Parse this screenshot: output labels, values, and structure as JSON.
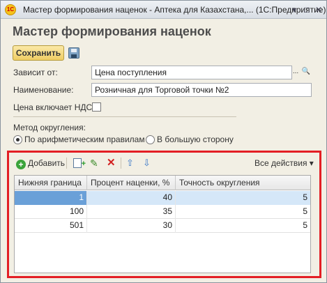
{
  "window": {
    "title": "Мастер формирования наценок - Аптека для Казахстана,... (1С:Предприятие)",
    "logo": "1С",
    "menu_glyph": "▾",
    "max_glyph": "□",
    "close_glyph": "✕"
  },
  "form": {
    "title": "Мастер формирования наценок",
    "save_label": "Сохранить",
    "depends_label": "Зависит от:",
    "depends_value": "Цена поступления",
    "depends_select_glyph": "...",
    "depends_search_glyph": "🔍",
    "name_label": "Наименование:",
    "name_value": "Розничная для Торговой точки №2",
    "vat_label": "Цена включает НДС:",
    "vat_checked": false,
    "rounding_label": "Метод округления:",
    "rounding_options": [
      {
        "label": "По арифметическим правилам",
        "selected": true
      },
      {
        "label": "В большую сторону",
        "selected": false
      }
    ]
  },
  "toolbar": {
    "add_label": "Добавить",
    "all_actions_label": "Все действия ▾",
    "icons": [
      "plus-icon",
      "copy-icon",
      "pencil-icon",
      "delete-icon",
      "arrow-up-icon",
      "arrow-down-icon"
    ]
  },
  "table": {
    "columns": [
      "Нижняя граница",
      "Процент наценки, %",
      "Точность округления"
    ],
    "rows": [
      [
        "1",
        "40",
        "5"
      ],
      [
        "100",
        "35",
        "5"
      ],
      [
        "501",
        "30",
        "5"
      ]
    ],
    "selected_row": 0
  },
  "colors": {
    "highlight_frame": "#e31e24",
    "save_button": "#efcd63",
    "selection": "#6aa0d8"
  }
}
